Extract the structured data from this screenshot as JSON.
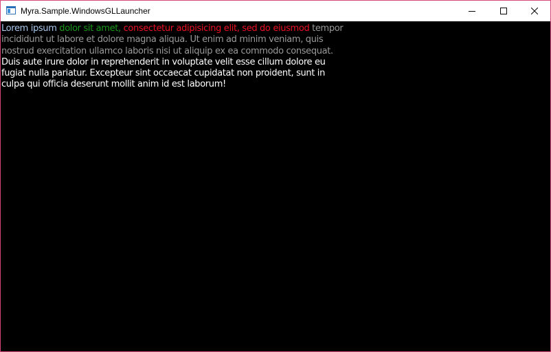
{
  "window": {
    "title": "Myra.Sample.WindowsGLLauncher",
    "controls": {
      "minimize_icon": "minimize-icon",
      "maximize_icon": "maximize-icon",
      "close_icon": "close-icon"
    }
  },
  "content": {
    "background": "#000000",
    "segments": [
      {
        "text": "Lorem ipsum ",
        "color": "#a8c8ee"
      },
      {
        "text": "dolor sit amet, ",
        "color": "#1a9a1a"
      },
      {
        "text": "consectetur adipisicing elit, sed do eiusmod",
        "color": "#ee1122"
      },
      {
        "text": " tempor incididunt ut labore et dolore magna aliqua. Ut enim ad minim veniam, quis nostrud exercitation ullamco laboris nisi ut aliquip ex ea commodo consequat.",
        "color": "#9a9a9a"
      },
      {
        "text": " Duis aute irure dolor in reprehenderit in voluptate velit esse cillum dolore eu fugiat nulla pariatur. Excepteur sint occaecat cupidatat non proident, sunt in culpa qui officia deserunt mollit anim id est laborum!",
        "color": "#ffffff"
      }
    ]
  }
}
